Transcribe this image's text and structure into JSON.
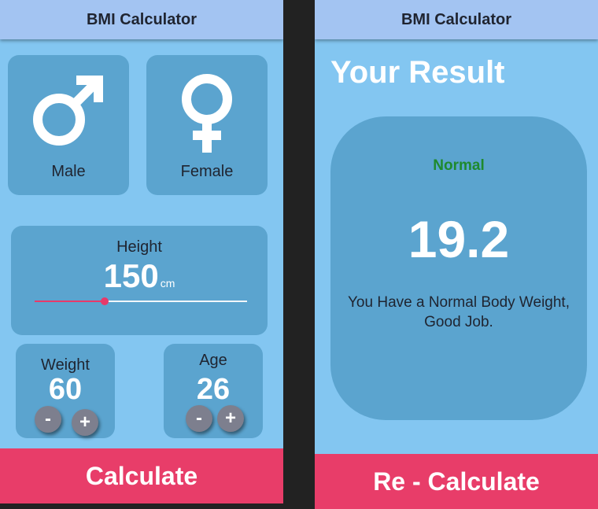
{
  "input_screen": {
    "app_title": "BMI Calculator",
    "gender": {
      "male_label": "Male",
      "female_label": "Female"
    },
    "height": {
      "label": "Height",
      "value": "150",
      "unit": "cm",
      "slider_fraction": 0.33,
      "slider_color": "#e8396a"
    },
    "weight": {
      "label": "Weight",
      "value": "60",
      "minus": "-",
      "plus": "+"
    },
    "age": {
      "label": "Age",
      "value": "26",
      "minus": "-",
      "plus": "+"
    },
    "calculate_label": "Calculate"
  },
  "result_screen": {
    "app_title": "BMI Calculator",
    "heading": "Your Result",
    "status": "Normal",
    "status_color": "#1e8a2e",
    "bmi_value": "19.2",
    "message": "You Have a Normal Body Weight, Good Job.",
    "recalculate_label": "Re - Calculate"
  },
  "colors": {
    "background": "#83c6f1",
    "card": "#5ba4cf",
    "appbar": "#a3c4f2",
    "accent": "#e83d69",
    "stepper": "#7d7f8e"
  }
}
